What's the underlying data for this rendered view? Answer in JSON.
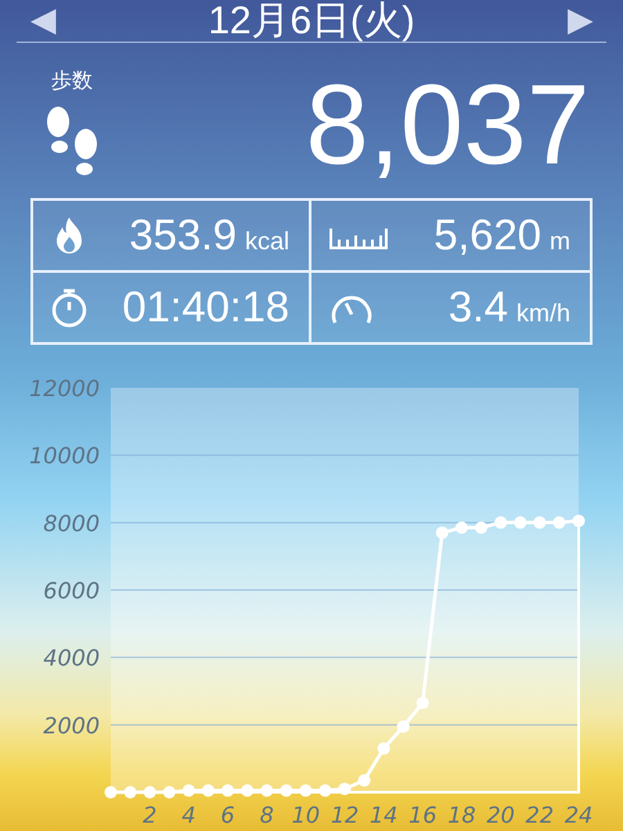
{
  "header": {
    "title": "12月6日(火)",
    "prev": "◀",
    "next": "▶"
  },
  "steps": {
    "label": "歩数",
    "value": "8,037"
  },
  "stats": [
    {
      "kind": "calories",
      "value": "353.9",
      "unit": "kcal"
    },
    {
      "kind": "distance",
      "value": "5,620",
      "unit": "m"
    },
    {
      "kind": "time",
      "value": "01:40:18"
    },
    {
      "kind": "speed",
      "value": "3.4",
      "unit": "km/h"
    }
  ],
  "chart_data": {
    "type": "line",
    "x": [
      0,
      1,
      2,
      3,
      4,
      5,
      6,
      7,
      8,
      9,
      10,
      11,
      12,
      13,
      14,
      15,
      16,
      17,
      18,
      19,
      20,
      21,
      22,
      23,
      24
    ],
    "series": [
      {
        "color": "#ffffff",
        "marker": true,
        "values": [
          0,
          0,
          0,
          0,
          50,
          50,
          50,
          50,
          50,
          50,
          50,
          50,
          100,
          350,
          1300,
          1950,
          2650,
          7700,
          7850,
          7850,
          8000,
          8000,
          8000,
          8000,
          8050
        ]
      }
    ],
    "grid": true,
    "xlim": [
      0,
      24
    ],
    "ylim": [
      0,
      12000
    ],
    "xticks": [
      2,
      4,
      6,
      8,
      10,
      12,
      14,
      16,
      18,
      20,
      22,
      24
    ],
    "yticks": [
      2000,
      4000,
      6000,
      8000,
      10000,
      12000
    ]
  }
}
